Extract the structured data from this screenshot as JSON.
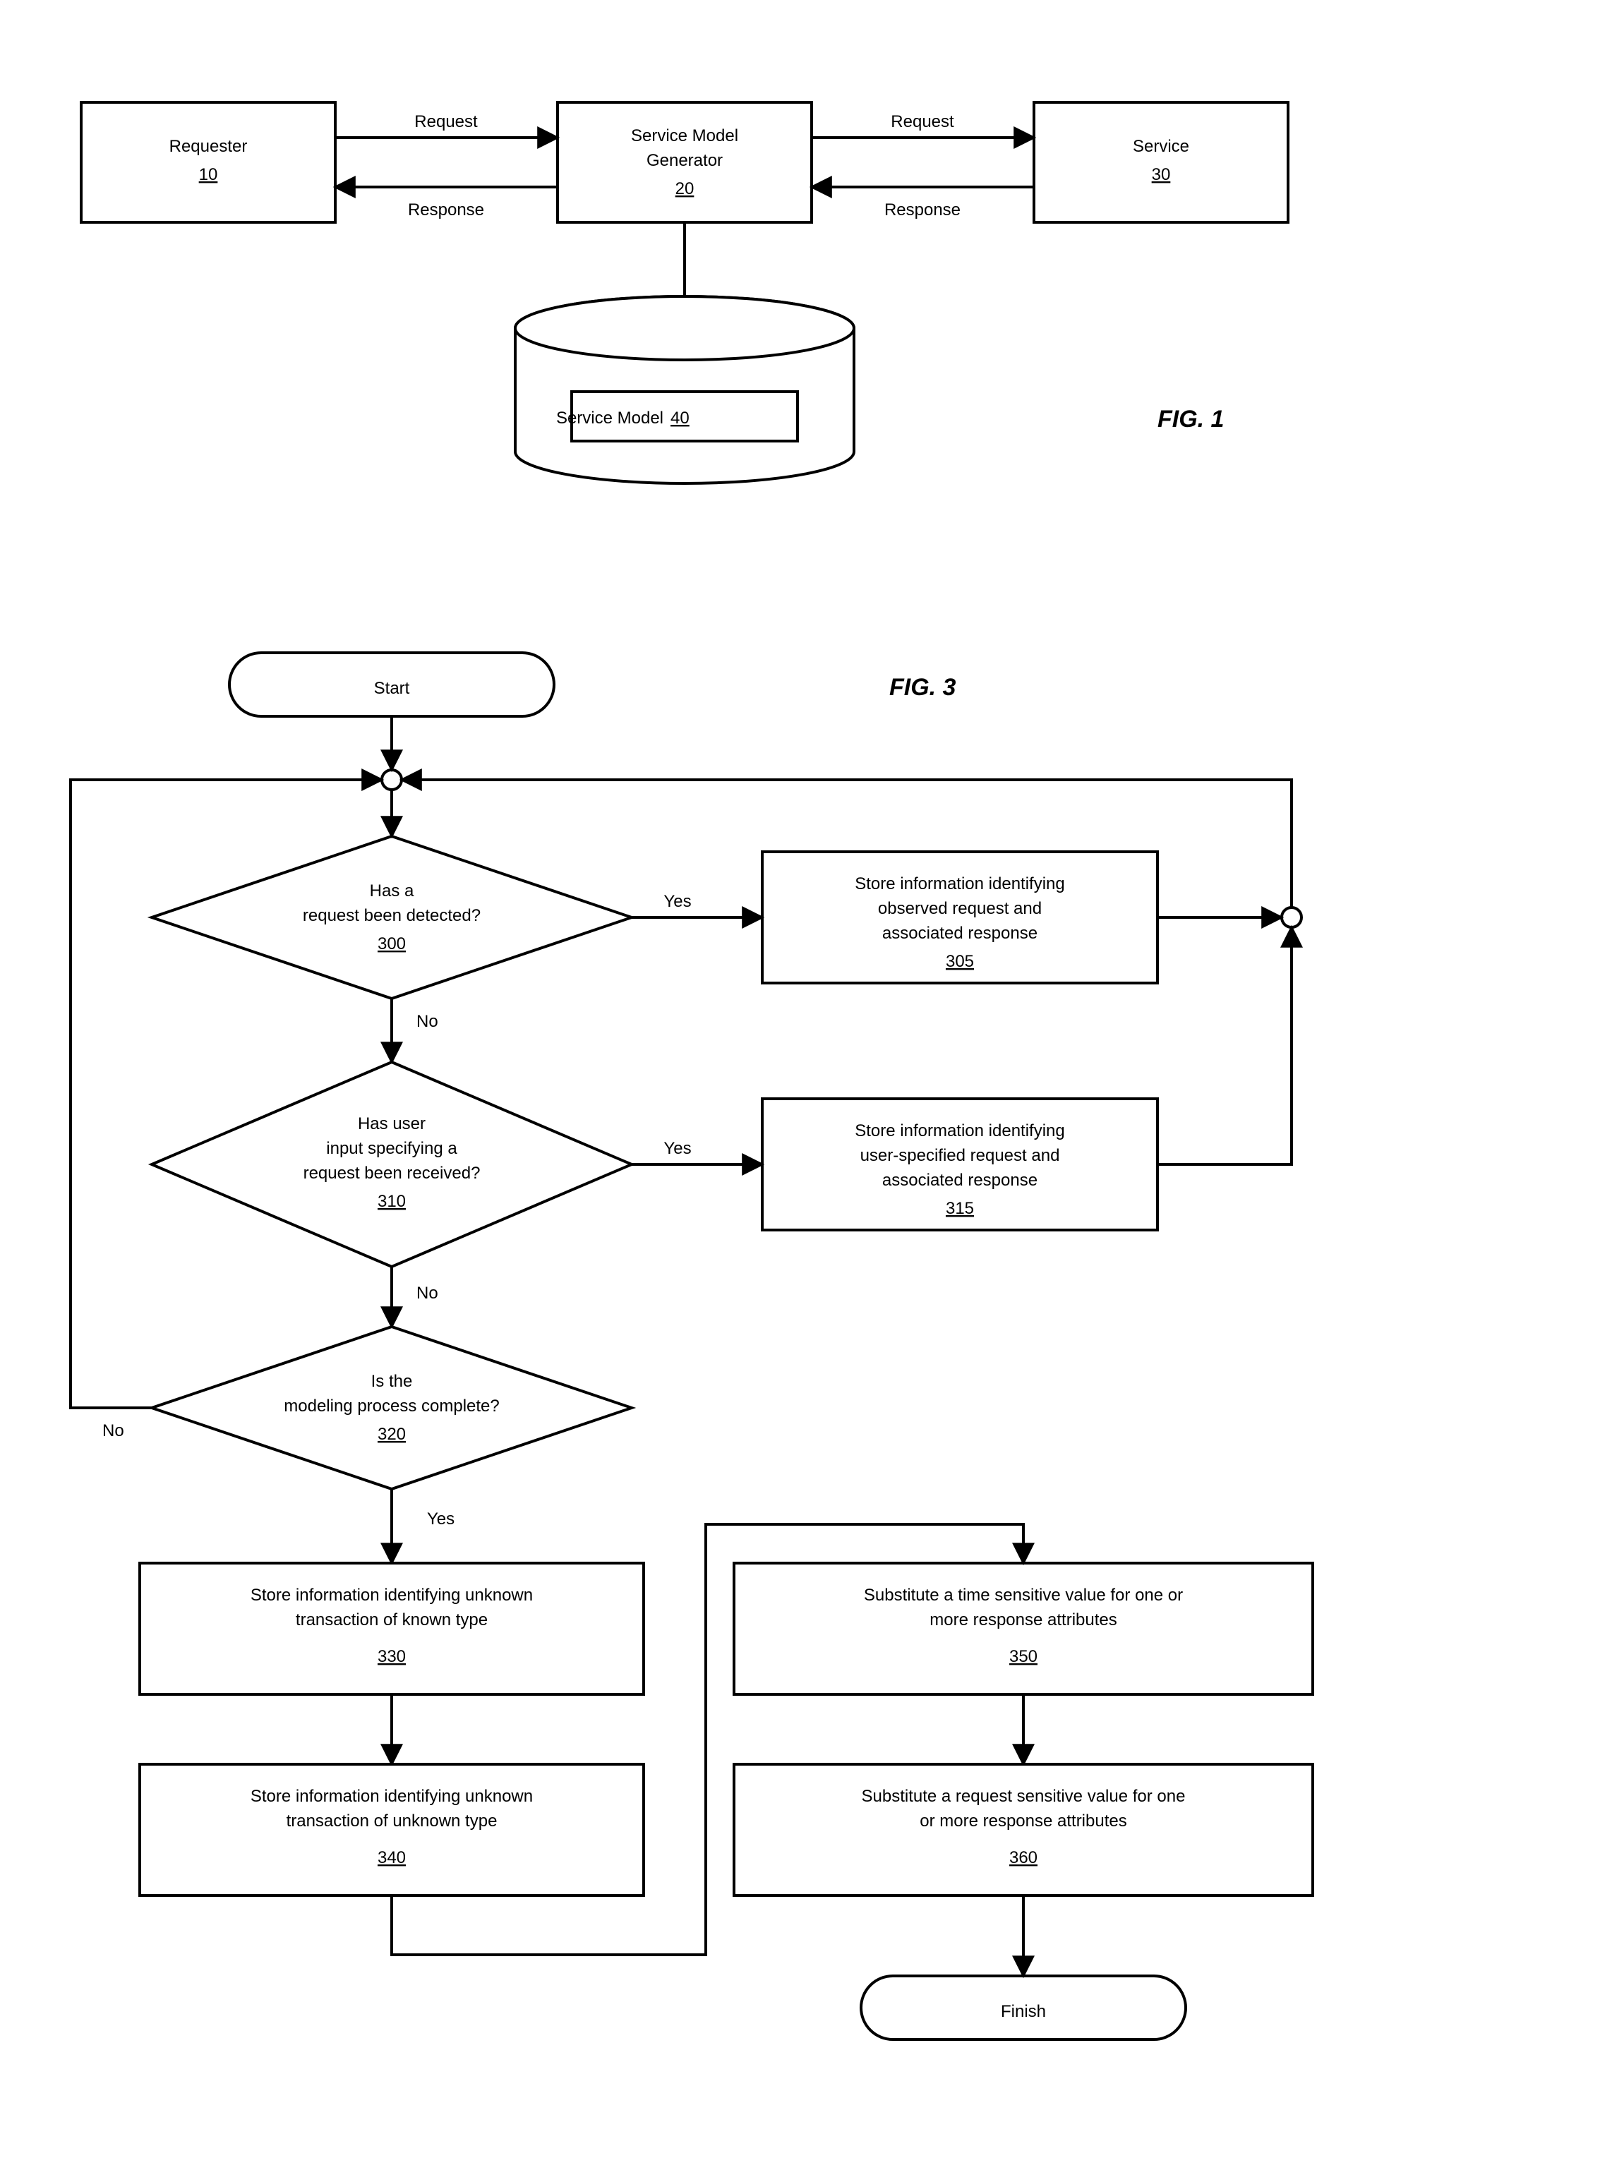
{
  "fig1": {
    "label": "FIG. 1",
    "requester": {
      "title": "Requester",
      "num": "10"
    },
    "smg": {
      "title_l1": "Service Model",
      "title_l2": "Generator",
      "num": "20"
    },
    "service": {
      "title": "Service",
      "num": "30"
    },
    "sm": {
      "title": "Service Model",
      "num": "40"
    },
    "edges": {
      "req": "Request",
      "resp": "Response"
    }
  },
  "fig3": {
    "label": "FIG. 3",
    "start": "Start",
    "finish": "Finish",
    "d300": {
      "l1": "Has a",
      "l2": "request been detected?",
      "num": "300"
    },
    "b305": {
      "l1": "Store information identifying",
      "l2": "observed request and",
      "l3": "associated response",
      "num": "305"
    },
    "d310": {
      "l1": "Has user",
      "l2": "input specifying a",
      "l3": "request been received?",
      "num": "310"
    },
    "b315": {
      "l1": "Store information identifying",
      "l2": "user-specified request and",
      "l3": "associated response",
      "num": "315"
    },
    "d320": {
      "l1": "Is the",
      "l2": "modeling process complete?",
      "num": "320"
    },
    "b330": {
      "l1": "Store information identifying unknown",
      "l2": "transaction of known type",
      "num": "330"
    },
    "b340": {
      "l1": "Store information identifying unknown",
      "l2": "transaction of unknown type",
      "num": "340"
    },
    "b350": {
      "l1": "Substitute a time sensitive value for one or",
      "l2": "more response attributes",
      "num": "350"
    },
    "b360": {
      "l1": "Substitute a request sensitive value for one",
      "l2": "or more response attributes",
      "num": "360"
    },
    "yn": {
      "yes": "Yes",
      "no": "No"
    }
  }
}
